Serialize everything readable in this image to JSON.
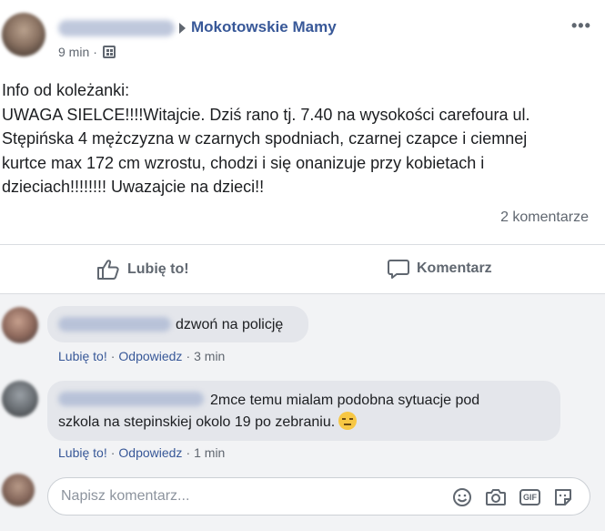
{
  "post": {
    "group_name": "Mokotowskie Mamy",
    "timestamp": "9 min",
    "separator": "·",
    "body_lines": [
      "Info od koleżanki:",
      "UWAGA SIELCE!!!!Witajcie. Dziś rano tj. 7.40 na wysokości carefoura ul.",
      "Stępińska 4 mężczyzna w czarnych spodniach, czarnej czapce i ciemnej",
      "kurtce max 172 cm wzrostu, chodzi i się onanizuje przy kobietach i",
      "dzieciach!!!!!!!! Uwazajcie na dzieci!!"
    ],
    "comments_count": "2 komentarze"
  },
  "actions": {
    "like_label": "Lubię to!",
    "comment_label": "Komentarz"
  },
  "comments": [
    {
      "text": "dzwoń na policję",
      "like": "Lubię to!",
      "reply": "Odpowiedz",
      "sep": "·",
      "time": "3 min"
    },
    {
      "text_line1": "2mce temu mialam podobna sytuacje pod",
      "text_line2": "szkola na stepinskiej okolo 19 po zebraniu.",
      "like": "Lubię to!",
      "reply": "Odpowiedz",
      "sep": "·",
      "time": "1 min"
    }
  ],
  "composer": {
    "placeholder": "Napisz komentarz...",
    "gif_label": "GIF"
  },
  "colors": {
    "link": "#385898",
    "muted": "#606770",
    "bubble": "#e4e6eb",
    "comments_bg": "#f2f3f5"
  },
  "icons": [
    "more-icon",
    "globe-icon",
    "thumbs-up-icon",
    "comment-bubble-icon",
    "smiley-icon",
    "camera-icon",
    "gif-icon",
    "sticker-icon"
  ]
}
